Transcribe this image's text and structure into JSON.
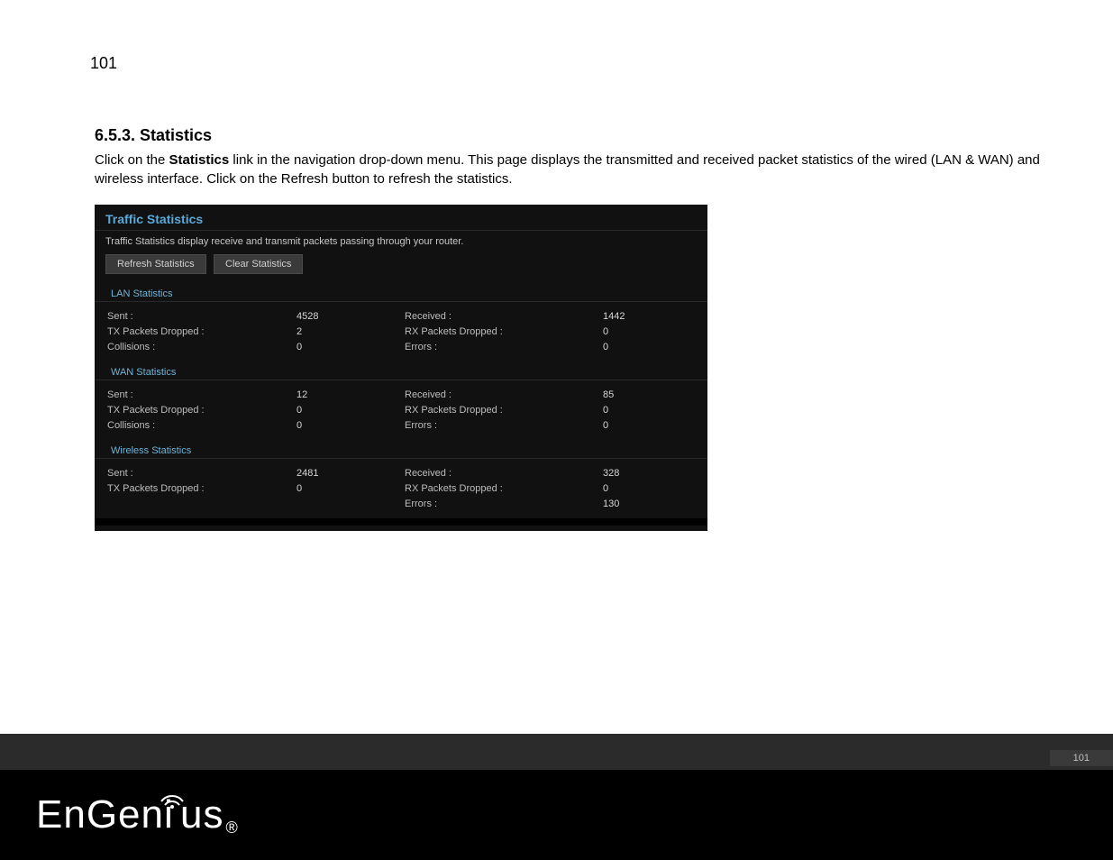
{
  "page_top_number": "101",
  "heading": "6.5.3. Statistics",
  "intro_pre": "Click on the ",
  "intro_bold": "Statistics",
  "intro_post": " link in the navigation drop-down menu. This page displays the transmitted and received packet statistics of the wired (LAN & WAN) and wireless interface.  Click on the Refresh button to refresh the statistics.",
  "panel": {
    "title": "Traffic Statistics",
    "desc": "Traffic Statistics display receive and transmit packets passing through your router.",
    "btn_refresh": "Refresh Statistics",
    "btn_clear": "Clear Statistics",
    "sections": {
      "lan": {
        "label": "LAN Statistics",
        "rows": {
          "sent_label": "Sent :",
          "sent_val": "4528",
          "recv_label": "Received :",
          "recv_val": "1442",
          "txd_label": "TX Packets Dropped :",
          "txd_val": "2",
          "rxd_label": "RX Packets Dropped :",
          "rxd_val": "0",
          "col_label": "Collisions :",
          "col_val": "0",
          "err_label": "Errors :",
          "err_val": "0"
        }
      },
      "wan": {
        "label": "WAN Statistics",
        "rows": {
          "sent_label": "Sent :",
          "sent_val": "12",
          "recv_label": "Received :",
          "recv_val": "85",
          "txd_label": "TX Packets Dropped :",
          "txd_val": "0",
          "rxd_label": "RX Packets Dropped :",
          "rxd_val": "0",
          "col_label": "Collisions :",
          "col_val": "0",
          "err_label": "Errors :",
          "err_val": "0"
        }
      },
      "wireless": {
        "label": "Wireless Statistics",
        "rows": {
          "sent_label": "Sent :",
          "sent_val": "2481",
          "recv_label": "Received :",
          "recv_val": "328",
          "txd_label": "TX Packets Dropped :",
          "txd_val": "0",
          "rxd_label": "RX Packets Dropped :",
          "rxd_val": "0",
          "err_label": "Errors :",
          "err_val": "130"
        }
      }
    }
  },
  "footer": {
    "page_number": "101",
    "logo_en": "EnGen",
    "logo_i": "i",
    "logo_us": "us",
    "logo_r": "®"
  }
}
